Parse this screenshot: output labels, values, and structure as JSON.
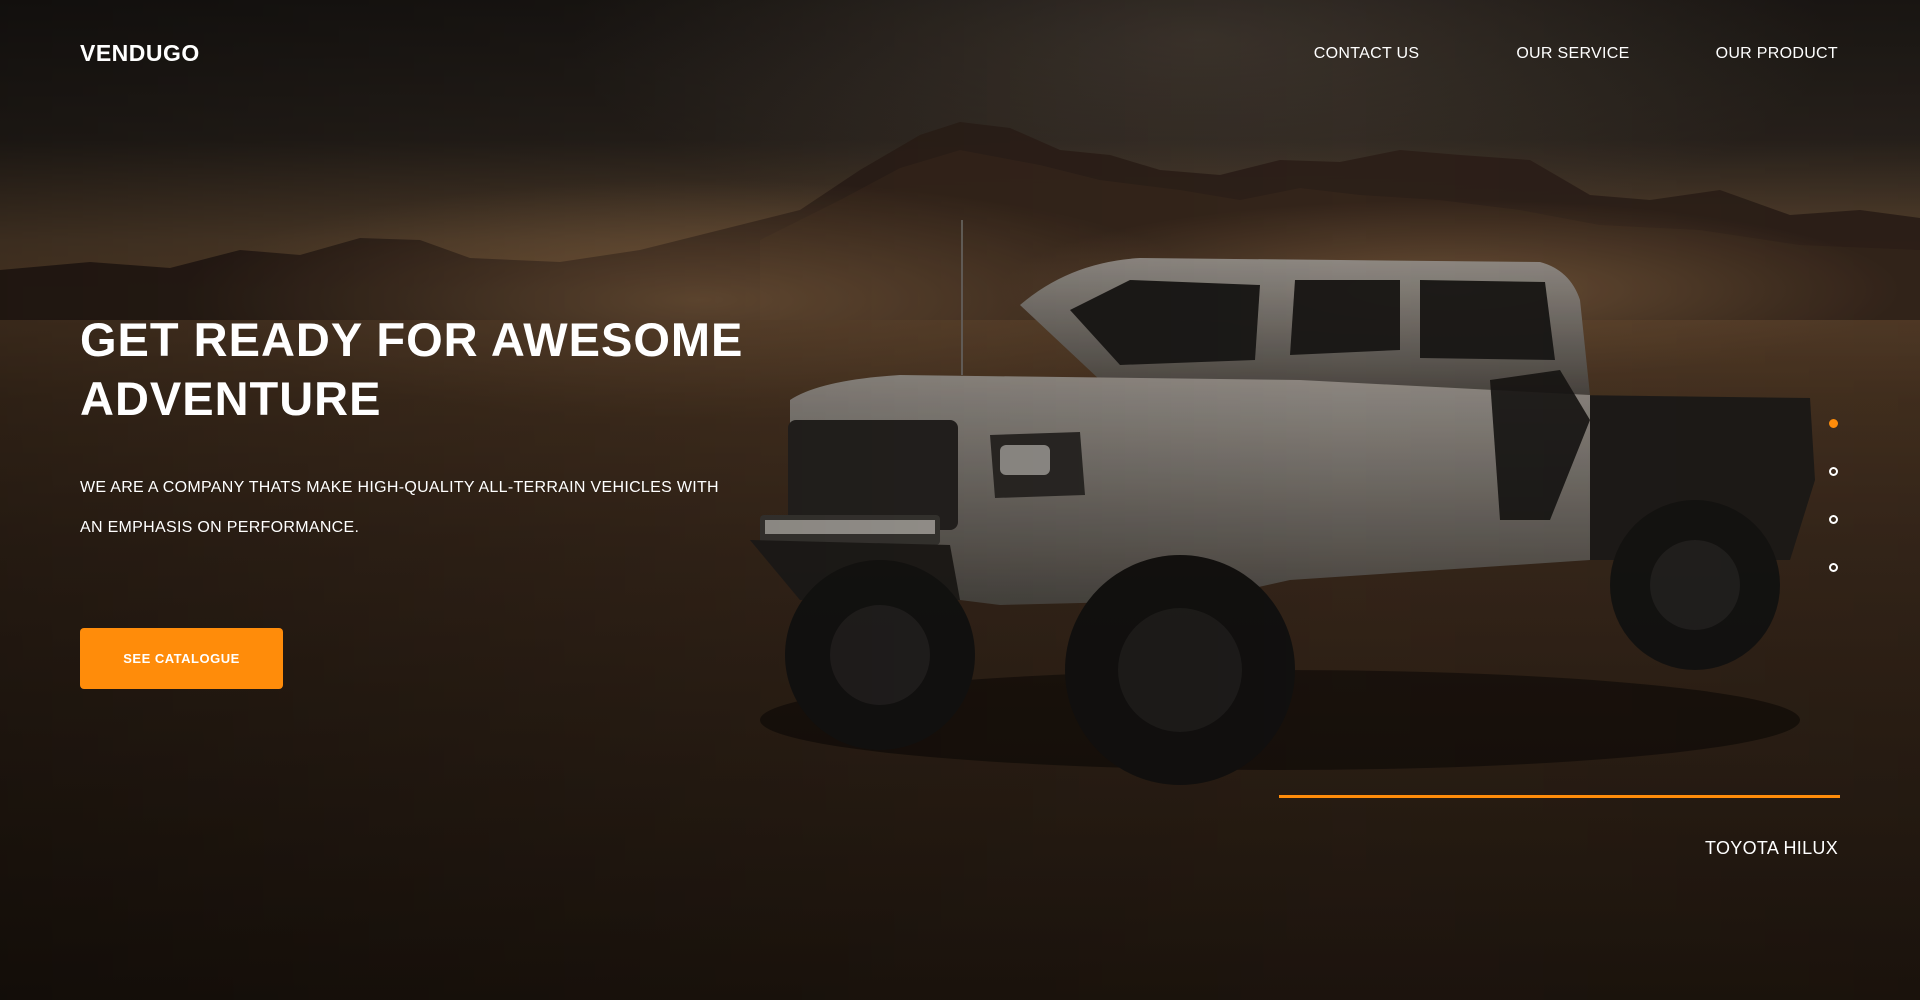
{
  "brand": {
    "logo": "VENDUGO"
  },
  "nav": {
    "items": [
      {
        "label": "CONTACT US"
      },
      {
        "label": "OUR SERVICE"
      },
      {
        "label": "OUR PRODUCT"
      }
    ]
  },
  "hero": {
    "title_line1": "GET READY FOR AWESOME",
    "title_line2": "ADVENTURE",
    "subtitle_line1": "WE ARE A COMPANY THATS MAKE HIGH-QUALITY ALL-TERRAIN VEHICLES WITH",
    "subtitle_line2": "AN EMPHASIS ON PERFORMANCE.",
    "cta_label": "SEE CATALOGUE"
  },
  "slider": {
    "dot_count": 4,
    "active_index": 0,
    "progress": 1.0,
    "model_name": "TOYOTA HILUX"
  },
  "colors": {
    "accent": "#ff8c0a",
    "text": "#ffffff"
  },
  "icons": [
    "slider-dot"
  ]
}
